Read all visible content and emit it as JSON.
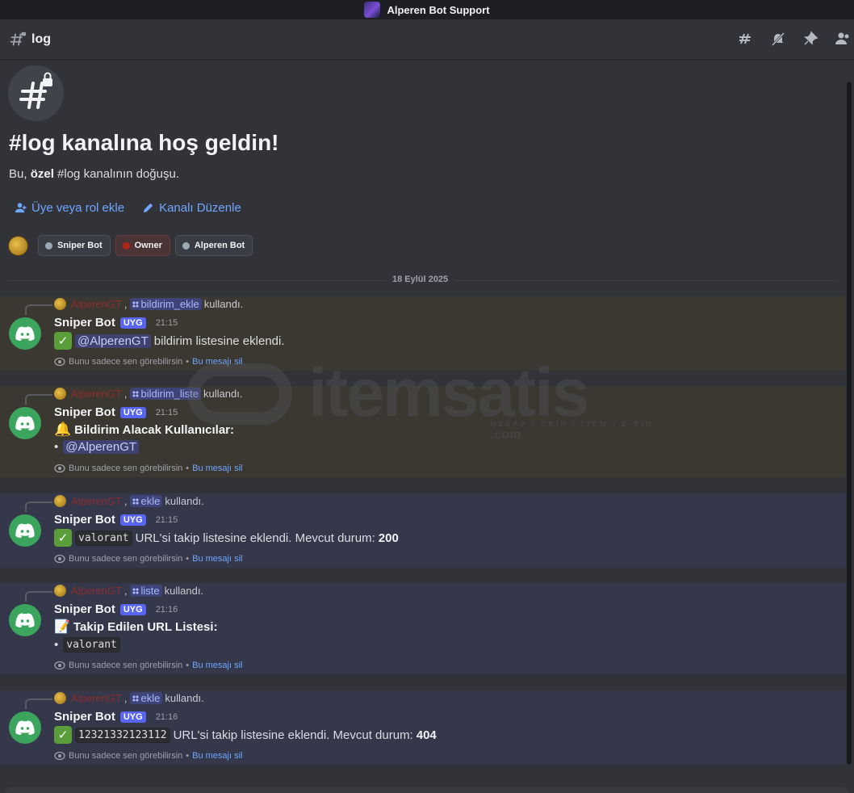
{
  "window": {
    "title": "Alperen Bot Support"
  },
  "channel": {
    "name": "log"
  },
  "welcome": {
    "title": "#log kanalına hoş geldin!",
    "sub_prefix": "Bu, ",
    "sub_bold": "özel",
    "sub_suffix": " #log kanalının doğuşu."
  },
  "actions": {
    "add_member": "Üye veya rol ekle",
    "edit_channel": "Kanalı Düzenle"
  },
  "roles": [
    {
      "label": "Sniper Bot"
    },
    {
      "label": "Owner"
    },
    {
      "label": "Alperen Bot"
    }
  ],
  "date_divider": "18 Eylül 2025",
  "common": {
    "reply_user": "AlperenGT",
    "reply_sep": ",",
    "reply_used": "kullandı.",
    "bot_name": "Sniper Bot",
    "bot_badge": "UYG",
    "ephemeral": "Bunu sadece sen görebilirsin",
    "ephemeral_sep": "•",
    "dismiss": "Bu mesajı sil",
    "bullet": "•"
  },
  "messages": [
    {
      "command": "bildirim_ekle",
      "time": "21:15",
      "mention": "@AlperenGT",
      "text": "bildirim listesine eklendi."
    },
    {
      "command": "bildirim_liste",
      "time": "21:15",
      "heading": "Bildirim Alacak Kullanıcılar:",
      "mention": "@AlperenGT"
    },
    {
      "command": "ekle",
      "time": "21:15",
      "code": "valorant",
      "text": "URL'si takip listesine eklendi. Mevcut durum:",
      "status": "200"
    },
    {
      "command": "liste",
      "time": "21:16",
      "heading": "Takip Edilen URL Listesi:",
      "code": "valorant"
    },
    {
      "command": "ekle",
      "time": "21:16",
      "code": "12321332123112",
      "text": "URL'si takip listesine eklendi. Mevcut durum:",
      "status": "404"
    }
  ],
  "watermark": {
    "brand": "itemsatis",
    "tagline": "HESAP / SKIN / ITEM / E-PIN",
    "domain": ".com"
  }
}
